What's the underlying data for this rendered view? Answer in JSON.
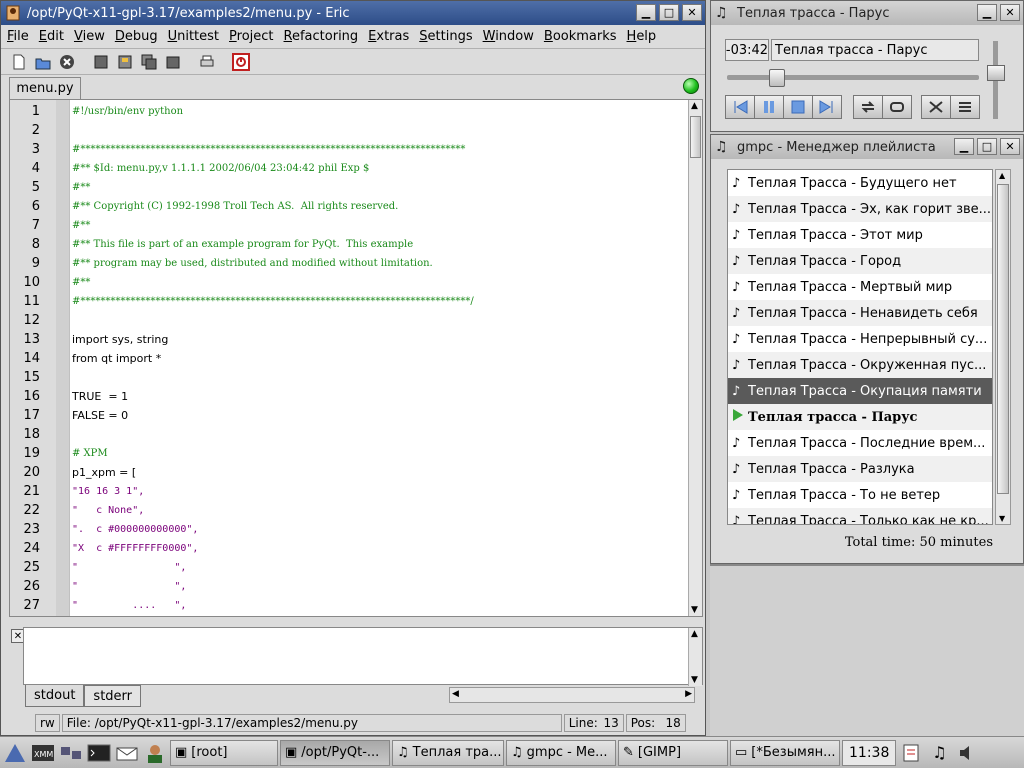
{
  "eric": {
    "title": "/opt/PyQt-x11-gpl-3.17/examples2/menu.py - Eric",
    "menu": [
      "File",
      "Edit",
      "View",
      "Debug",
      "Unittest",
      "Project",
      "Refactoring",
      "Extras",
      "Settings",
      "Window",
      "Bookmarks",
      "Help"
    ],
    "tab": "menu.py",
    "code_lines": [
      {
        "n": "1",
        "t": "#!/usr/bin/env python",
        "k": "com"
      },
      {
        "n": "2",
        "t": "",
        "k": "id"
      },
      {
        "n": "3",
        "t": "#*****************************************************************************",
        "k": "com"
      },
      {
        "n": "4",
        "t": "#** $Id: menu.py,v 1.1.1.1 2002/06/04 23:04:42 phil Exp $",
        "k": "com"
      },
      {
        "n": "5",
        "t": "#**",
        "k": "com"
      },
      {
        "n": "6",
        "t": "#** Copyright (C) 1992-1998 Troll Tech AS.  All rights reserved.",
        "k": "com"
      },
      {
        "n": "7",
        "t": "#**",
        "k": "com"
      },
      {
        "n": "8",
        "t": "#** This file is part of an example program for PyQt.  This example",
        "k": "com"
      },
      {
        "n": "9",
        "t": "#** program may be used, distributed and modified without limitation.",
        "k": "com"
      },
      {
        "n": "10",
        "t": "#**",
        "k": "com"
      },
      {
        "n": "11",
        "t": "#******************************************************************************/",
        "k": "com"
      },
      {
        "n": "12",
        "t": "",
        "k": "id"
      },
      {
        "n": "13",
        "t": "import sys, string",
        "k": "import"
      },
      {
        "n": "14",
        "t": "from qt import *",
        "k": "from"
      },
      {
        "n": "15",
        "t": "",
        "k": "id"
      },
      {
        "n": "16",
        "t": "TRUE  = 1",
        "k": "assign"
      },
      {
        "n": "17",
        "t": "FALSE = 0",
        "k": "assign"
      },
      {
        "n": "18",
        "t": "",
        "k": "id"
      },
      {
        "n": "19",
        "t": "# XPM",
        "k": "com"
      },
      {
        "n": "20",
        "t": "p1_xpm = [",
        "k": "list"
      },
      {
        "n": "21",
        "t": "\"16 16 3 1\",",
        "k": "str"
      },
      {
        "n": "22",
        "t": "\"   c None\",",
        "k": "str"
      },
      {
        "n": "23",
        "t": "\".  c #000000000000\",",
        "k": "str"
      },
      {
        "n": "24",
        "t": "\"X  c #FFFFFFFF0000\",",
        "k": "str"
      },
      {
        "n": "25",
        "t": "\"                \",",
        "k": "str"
      },
      {
        "n": "26",
        "t": "\"                \",",
        "k": "str"
      },
      {
        "n": "27",
        "t": "\"         ....   \",",
        "k": "str"
      }
    ],
    "output_tabs": [
      "stdout",
      "stderr"
    ],
    "status": {
      "mode": "rw",
      "file": "File: /opt/PyQt-x11-gpl-3.17/examples2/menu.py",
      "line_label": "Line:",
      "line": "13",
      "pos_label": "Pos:",
      "pos": "18"
    }
  },
  "player": {
    "title": "Теплая трасса - Парус",
    "time": "-03:42",
    "song": "Теплая трасса - Парус",
    "seek_fraction": 0.2
  },
  "playlist": {
    "title": "gmpc - Менеджер плейлиста",
    "items": [
      "Теплая Трасса - Будущего нет",
      "Теплая Трасса - Эх, как горит зве...",
      "Теплая Трасса - Этот мир",
      "Теплая Трасса - Город",
      "Теплая Трасса - Мертвый мир",
      "Теплая Трасса - Ненавидеть себя",
      "Теплая Трасса - Непрерывный су...",
      "Теплая Трасса - Окруженная пус...",
      "Теплая Трасса - Окупация памяти",
      "Теплая трасса - Парус",
      "Теплая Трасса - Последние врем...",
      "Теплая Трасса - Разлука",
      "Теплая Трасса - То не ветер",
      "Теплая Трасса - Только как не кр..."
    ],
    "selected_index": 8,
    "playing_index": 9,
    "total_time": "Total time: 50 minutes"
  },
  "taskbar": {
    "tasks": [
      "[root]",
      "/opt/PyQt-...",
      "Теплая тра...",
      "gmpc - Ме...",
      "[GIMP]",
      "[*Безымян..."
    ],
    "clock": "11:38"
  },
  "colors": {
    "title_active": "#3d5d98",
    "comment": "#1a8a1a",
    "keyword": "#000070",
    "string": "#7a007a",
    "number": "#007070",
    "selected_row": "#5a5a5a"
  }
}
